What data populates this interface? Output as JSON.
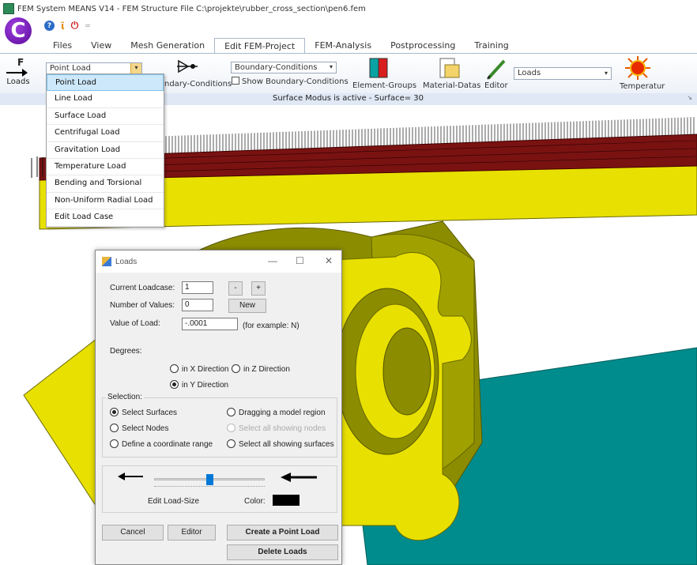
{
  "window": {
    "title": "FEM System MEANS V14 - FEM Structure File C:\\projekte\\rubber_cross_section\\pen6.fem",
    "logo_letter": "C",
    "qa_help": "?",
    "qa_bulb": "ϊ",
    "qa_stop": "⏻",
    "qa_more": "="
  },
  "tabs": [
    {
      "label": "Files"
    },
    {
      "label": "View"
    },
    {
      "label": "Mesh Generation"
    },
    {
      "label": "Edit FEM-Project"
    },
    {
      "label": "FEM-Analysis"
    },
    {
      "label": "Postprocessing"
    },
    {
      "label": "Training"
    }
  ],
  "ribbon": {
    "loads_letter": "F",
    "loads_label": "Loads",
    "load_type_value": "Point Load",
    "boundary_label": "ndary-Conditions",
    "boundary_combo": "Boundary-Conditions",
    "show_boundary_label": "Show Boundary-Conditions",
    "element_groups_label": "Element-Groups",
    "material_label": "Material-Datas",
    "editor_label": "Editor",
    "loads_combo": "Loads",
    "temperatur_label": "Temperatur",
    "status": "Surface Modus is active - Surface= 30"
  },
  "dropdown": {
    "items": [
      "Point Load",
      "Line Load",
      "Surface Load",
      "Centrifugal Load",
      "Gravitation Load",
      "Temperature Load",
      "Bending and Torsional",
      "Non-Uniform Radial Load",
      "Edit Load Case"
    ],
    "selected": 0
  },
  "dialog": {
    "title": "Loads",
    "current_loadcase_label": "Current Loadcase:",
    "current_loadcase_value": "1",
    "minus_label": "-",
    "plus_label": "+",
    "number_values_label": "Number of Values:",
    "number_values_value": "0",
    "new_label": "New",
    "value_load_label": "Value of Load:",
    "value_load_value": "-.0001",
    "example_label": "(for example: N)",
    "degrees_label": "Degrees:",
    "x_dir": "in X Direction",
    "z_dir": "in Z Direction",
    "y_dir": "in Y Direction",
    "selection_label": "Selection:",
    "sel_surfaces": "Select Surfaces",
    "sel_drag": "Dragging a model region",
    "sel_nodes": "Select Nodes",
    "sel_all_nodes": "Select all showing nodes",
    "sel_coord": "Define a coordinate range",
    "sel_all_surfaces": "Select all showing surfaces",
    "edit_load_size": "Edit Load-Size",
    "color_label": "Color:",
    "color_value": "#000000",
    "slider_level": 0.5,
    "cancel_label": "Cancel",
    "editor_label": "Editor",
    "create_label": "Create a Point Load",
    "delete_label": "Delete Loads"
  },
  "colors": {
    "ribbon_bg": "#e9eef6",
    "yellow": "#e8e000",
    "olive": "#8a8a00",
    "teal": "#008c8c",
    "red_load": "#8b1a1a"
  }
}
